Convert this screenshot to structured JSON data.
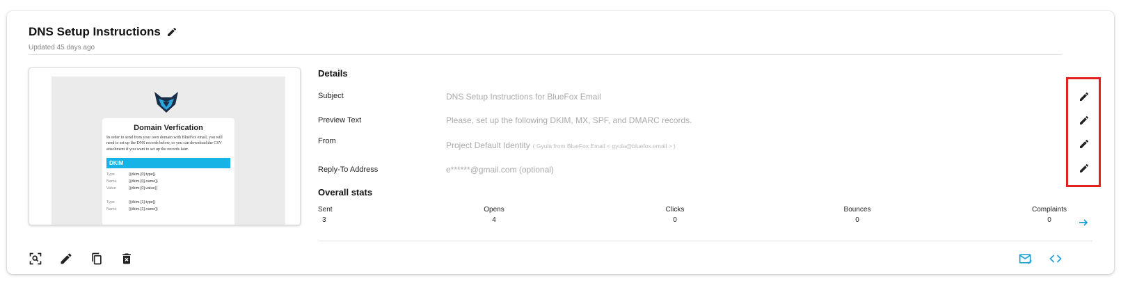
{
  "header": {
    "title": "DNS Setup Instructions",
    "updated": "Updated 45 days ago"
  },
  "preview": {
    "email_title": "Domain Verfication",
    "email_text": "In order to send from your own domain with BlueFox email, you will need to set up the DNS records below, or you can download the CSV attachment if you want to set up the records later.",
    "section_label": "DKIM",
    "rows": [
      {
        "key": "Type",
        "value": "{{dkim.[0].type}}"
      },
      {
        "key": "Name",
        "value": "{{dkim.[0].name}}"
      },
      {
        "key": "Value",
        "value": "{{dkim.[0].value}}"
      },
      {
        "key": "Type",
        "value": "{{dkim.[1].type}}"
      },
      {
        "key": "Name",
        "value": "{{dkim.[1].name}}"
      }
    ]
  },
  "details": {
    "heading": "Details",
    "subject_label": "Subject",
    "subject_value": "DNS Setup Instructions for BlueFox Email",
    "preview_label": "Preview Text",
    "preview_value": "Please, set up the following DKIM, MX, SPF, and DMARC records.",
    "from_label": "From",
    "from_value": "Project Default Identity",
    "from_hint": "( Gyula from BlueFox Email < gyula@bluefox.email > )",
    "reply_label": "Reply-To Address",
    "reply_value": "e******@gmail.com (optional)"
  },
  "stats": {
    "heading": "Overall stats",
    "items": [
      {
        "label": "Sent",
        "value": "3"
      },
      {
        "label": "Opens",
        "value": "4"
      },
      {
        "label": "Clicks",
        "value": "0"
      },
      {
        "label": "Bounces",
        "value": "0"
      },
      {
        "label": "Complaints",
        "value": "0"
      }
    ]
  },
  "colors": {
    "accent": "#1a9fd6",
    "highlight": "#e51e1e"
  },
  "icons": {
    "title_edit": "pencil-icon",
    "field_edit": "pencil-icon",
    "stats_more": "arrow-right-icon",
    "toolbar": [
      "preview-search-icon",
      "edit-icon",
      "copy-icon",
      "delete-icon",
      "send-test-email-icon",
      "code-icon"
    ]
  }
}
